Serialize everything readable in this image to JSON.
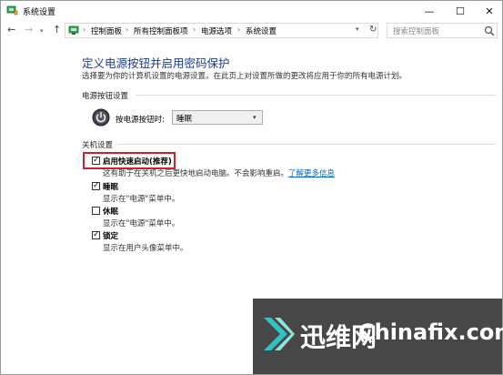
{
  "window": {
    "title": "系统设置"
  },
  "controls": {
    "minimize": "—",
    "maximize": "☐",
    "close": "✕"
  },
  "nav": {
    "back": "←",
    "forward": "→",
    "recent": "▾",
    "up": "↑"
  },
  "address": {
    "breadcrumbs": [
      "控制面板",
      "所有控制面板项",
      "电源选项",
      "系统设置"
    ],
    "separator": "›",
    "dropdown": "▾",
    "refresh": "↻"
  },
  "search": {
    "placeholder": "搜索控制面板"
  },
  "page": {
    "title": "定义电源按钮并启用密码保护",
    "description": "选择要为你的计算机设置的电源设置。在此页上对设置所做的更改将应用于你的所有电源计划。"
  },
  "power_buttons": {
    "section_label": "电源按钮设置",
    "press_label": "按电源按钮时:",
    "selected": "睡眠",
    "arrow": "▾"
  },
  "shutdown": {
    "section_label": "关机设置",
    "options": [
      {
        "label": "启用快速启动(推荐)",
        "description": "这有助于在关机之后更快地启动电脑。不会影响重启。",
        "link": "了解更多信息",
        "checked": true
      },
      {
        "label": "睡眠",
        "description": "显示在\"电源\"菜单中。",
        "checked": true
      },
      {
        "label": "休眠",
        "description": "显示在\"电源\"菜单中。",
        "checked": false
      },
      {
        "label": "锁定",
        "description": "显示在用户头像菜单中。",
        "checked": true
      }
    ]
  },
  "checkmark": "✓",
  "watermark": {
    "cn": "迅维网",
    "en": "Chinafix.com"
  },
  "colors": {
    "title_blue": "#1e3a8a",
    "link_blue": "#0066cc",
    "highlight_red": "#d0202a",
    "watermark_accent": "#2ec4c4"
  }
}
